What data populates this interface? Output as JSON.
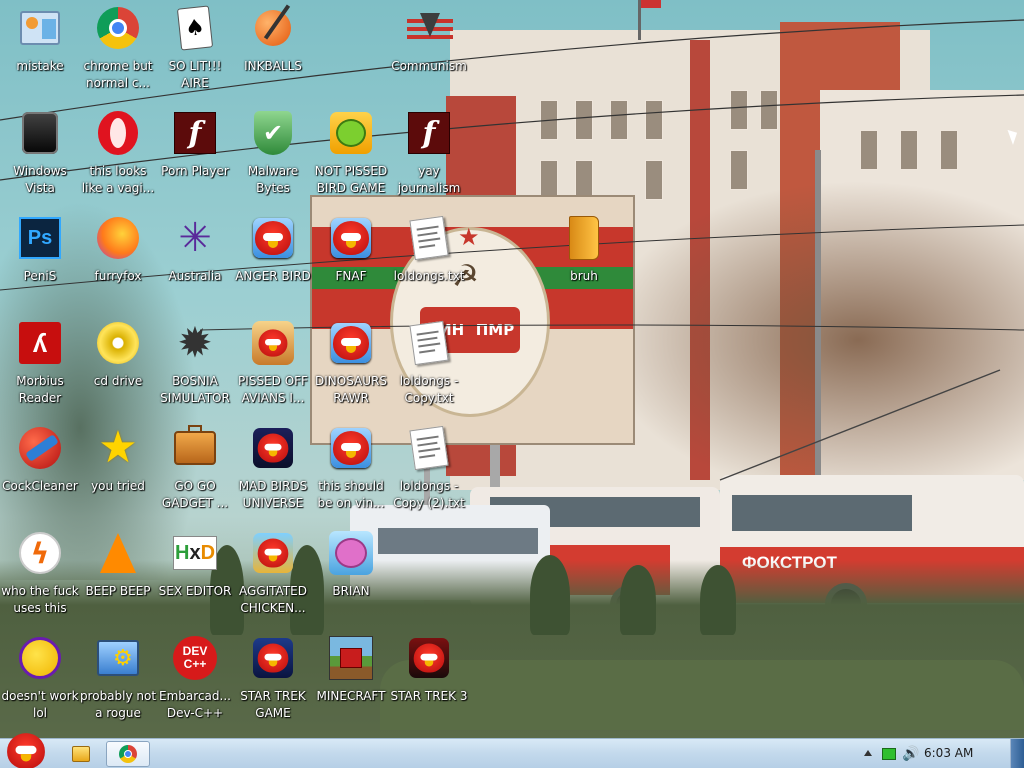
{
  "desktop": {
    "icons": [
      {
        "label": "mistake",
        "icon": "control-panel-icon"
      },
      {
        "label": "chrome but normal c...",
        "icon": "chrome-icon"
      },
      {
        "label": "SO LIT!!! AIRE",
        "icon": "solitaire-icon"
      },
      {
        "label": "INKBALLS",
        "icon": "inkball-icon"
      },
      {
        "label": "Communism",
        "icon": "communism-logo-icon"
      },
      {
        "label": "Windows Vista",
        "icon": "windows-vista-icon"
      },
      {
        "label": "this looks like a vagi...",
        "icon": "opera-icon"
      },
      {
        "label": "Porn Player",
        "icon": "flash-player-icon"
      },
      {
        "label": "Malware Bytes",
        "icon": "shield-check-icon"
      },
      {
        "label": "NOT PISSED BIRD GAME",
        "icon": "bad-piggies-icon"
      },
      {
        "label": "yay journalism",
        "icon": "flash-player-icon"
      },
      {
        "label": "PeniS",
        "icon": "photoshop-icon"
      },
      {
        "label": "furryfox",
        "icon": "firefox-icon"
      },
      {
        "label": "Australia",
        "icon": "spider-solitaire-icon"
      },
      {
        "label": "ANGER BIRD",
        "icon": "angry-birds-icon"
      },
      {
        "label": "FNAF",
        "icon": "angry-birds-icon"
      },
      {
        "label": "loldongs.txt",
        "icon": "text-file-icon"
      },
      {
        "label": "bruh",
        "icon": "folder-icon"
      },
      {
        "label": "Morbius Reader",
        "icon": "adobe-reader-icon"
      },
      {
        "label": "cd drive",
        "icon": "cd-drive-icon"
      },
      {
        "label": "BOSNIA SIMULATOR",
        "icon": "minesweeper-icon"
      },
      {
        "label": "PISSED OFF AVIANS I...",
        "icon": "angry-birds-seasons-icon"
      },
      {
        "label": "DINOSAURS RAWR",
        "icon": "angry-birds-icon"
      },
      {
        "label": "loldongs - Copy.txt",
        "icon": "text-file-icon"
      },
      {
        "label": "CockCleaner",
        "icon": "ccleaner-icon"
      },
      {
        "label": "you tried",
        "icon": "star-icon"
      },
      {
        "label": "GO GO GADGET ...",
        "icon": "briefcase-icon"
      },
      {
        "label": "MAD BIRDS UNIVERSE",
        "icon": "angry-birds-space-icon"
      },
      {
        "label": "this should be on vin...",
        "icon": "angry-birds-icon"
      },
      {
        "label": "loldongs - Copy (2).txt",
        "icon": "text-file-icon"
      },
      {
        "label": "who the fuck uses this",
        "icon": "winamp-icon"
      },
      {
        "label": "BEEP BEEP",
        "icon": "vlc-cone-icon"
      },
      {
        "label": "SEX EDITOR",
        "icon": "hxd-editor-icon"
      },
      {
        "label": "AGGITATED CHICKEN...",
        "icon": "angry-birds-rio-icon"
      },
      {
        "label": "BRIAN",
        "icon": "angry-birds-stella-icon"
      },
      {
        "label": "doesn't work lol",
        "icon": "yahoo-messenger-icon"
      },
      {
        "label": "probably not a rogue",
        "icon": "system-utility-icon"
      },
      {
        "label": "Embarcad... Dev-C++",
        "icon": "dev-cpp-icon"
      },
      {
        "label": "STAR TREK GAME",
        "icon": "angry-birds-star-wars-icon"
      },
      {
        "label": "MINECRAFT",
        "icon": "angry-birds-minecraft-icon"
      },
      {
        "label": "STAR TREK 3",
        "icon": "angry-birds-star-wars-2-icon"
      }
    ],
    "wallpaper_sign": {
      "left_text": "РМН",
      "right_text": "ПМР"
    },
    "bus_text": "ФОКСТРОТ"
  },
  "taskbar": {
    "start_icon": "angry-bird-start-icon",
    "pinned": [
      "explorer-icon",
      "chrome-icon"
    ],
    "clock": "6:03 AM",
    "tray_icons": [
      "show-hidden-icons-arrow",
      "battery-icon",
      "volume-icon"
    ]
  },
  "colors": {
    "taskbar": "#c3d9ec",
    "sky": "#8fc3c9",
    "icon_label": "#ffffff"
  }
}
